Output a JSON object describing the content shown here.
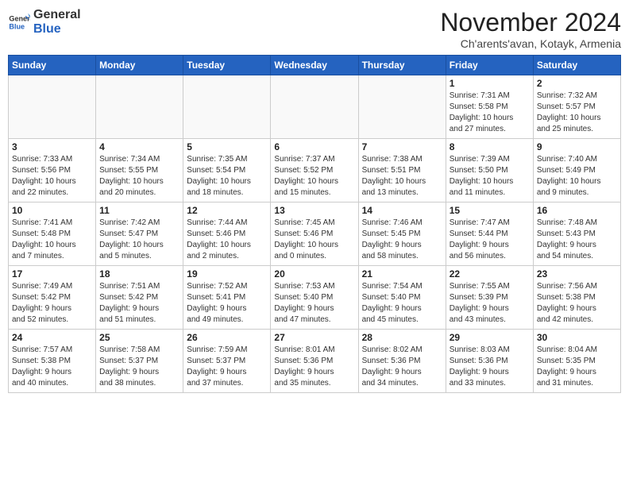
{
  "header": {
    "logo_general": "General",
    "logo_blue": "Blue",
    "title": "November 2024",
    "subtitle": "Ch'arents'avan, Kotayk, Armenia"
  },
  "weekdays": [
    "Sunday",
    "Monday",
    "Tuesday",
    "Wednesday",
    "Thursday",
    "Friday",
    "Saturday"
  ],
  "weeks": [
    [
      {
        "day": "",
        "info": ""
      },
      {
        "day": "",
        "info": ""
      },
      {
        "day": "",
        "info": ""
      },
      {
        "day": "",
        "info": ""
      },
      {
        "day": "",
        "info": ""
      },
      {
        "day": "1",
        "info": "Sunrise: 7:31 AM\nSunset: 5:58 PM\nDaylight: 10 hours\nand 27 minutes."
      },
      {
        "day": "2",
        "info": "Sunrise: 7:32 AM\nSunset: 5:57 PM\nDaylight: 10 hours\nand 25 minutes."
      }
    ],
    [
      {
        "day": "3",
        "info": "Sunrise: 7:33 AM\nSunset: 5:56 PM\nDaylight: 10 hours\nand 22 minutes."
      },
      {
        "day": "4",
        "info": "Sunrise: 7:34 AM\nSunset: 5:55 PM\nDaylight: 10 hours\nand 20 minutes."
      },
      {
        "day": "5",
        "info": "Sunrise: 7:35 AM\nSunset: 5:54 PM\nDaylight: 10 hours\nand 18 minutes."
      },
      {
        "day": "6",
        "info": "Sunrise: 7:37 AM\nSunset: 5:52 PM\nDaylight: 10 hours\nand 15 minutes."
      },
      {
        "day": "7",
        "info": "Sunrise: 7:38 AM\nSunset: 5:51 PM\nDaylight: 10 hours\nand 13 minutes."
      },
      {
        "day": "8",
        "info": "Sunrise: 7:39 AM\nSunset: 5:50 PM\nDaylight: 10 hours\nand 11 minutes."
      },
      {
        "day": "9",
        "info": "Sunrise: 7:40 AM\nSunset: 5:49 PM\nDaylight: 10 hours\nand 9 minutes."
      }
    ],
    [
      {
        "day": "10",
        "info": "Sunrise: 7:41 AM\nSunset: 5:48 PM\nDaylight: 10 hours\nand 7 minutes."
      },
      {
        "day": "11",
        "info": "Sunrise: 7:42 AM\nSunset: 5:47 PM\nDaylight: 10 hours\nand 5 minutes."
      },
      {
        "day": "12",
        "info": "Sunrise: 7:44 AM\nSunset: 5:46 PM\nDaylight: 10 hours\nand 2 minutes."
      },
      {
        "day": "13",
        "info": "Sunrise: 7:45 AM\nSunset: 5:46 PM\nDaylight: 10 hours\nand 0 minutes."
      },
      {
        "day": "14",
        "info": "Sunrise: 7:46 AM\nSunset: 5:45 PM\nDaylight: 9 hours\nand 58 minutes."
      },
      {
        "day": "15",
        "info": "Sunrise: 7:47 AM\nSunset: 5:44 PM\nDaylight: 9 hours\nand 56 minutes."
      },
      {
        "day": "16",
        "info": "Sunrise: 7:48 AM\nSunset: 5:43 PM\nDaylight: 9 hours\nand 54 minutes."
      }
    ],
    [
      {
        "day": "17",
        "info": "Sunrise: 7:49 AM\nSunset: 5:42 PM\nDaylight: 9 hours\nand 52 minutes."
      },
      {
        "day": "18",
        "info": "Sunrise: 7:51 AM\nSunset: 5:42 PM\nDaylight: 9 hours\nand 51 minutes."
      },
      {
        "day": "19",
        "info": "Sunrise: 7:52 AM\nSunset: 5:41 PM\nDaylight: 9 hours\nand 49 minutes."
      },
      {
        "day": "20",
        "info": "Sunrise: 7:53 AM\nSunset: 5:40 PM\nDaylight: 9 hours\nand 47 minutes."
      },
      {
        "day": "21",
        "info": "Sunrise: 7:54 AM\nSunset: 5:40 PM\nDaylight: 9 hours\nand 45 minutes."
      },
      {
        "day": "22",
        "info": "Sunrise: 7:55 AM\nSunset: 5:39 PM\nDaylight: 9 hours\nand 43 minutes."
      },
      {
        "day": "23",
        "info": "Sunrise: 7:56 AM\nSunset: 5:38 PM\nDaylight: 9 hours\nand 42 minutes."
      }
    ],
    [
      {
        "day": "24",
        "info": "Sunrise: 7:57 AM\nSunset: 5:38 PM\nDaylight: 9 hours\nand 40 minutes."
      },
      {
        "day": "25",
        "info": "Sunrise: 7:58 AM\nSunset: 5:37 PM\nDaylight: 9 hours\nand 38 minutes."
      },
      {
        "day": "26",
        "info": "Sunrise: 7:59 AM\nSunset: 5:37 PM\nDaylight: 9 hours\nand 37 minutes."
      },
      {
        "day": "27",
        "info": "Sunrise: 8:01 AM\nSunset: 5:36 PM\nDaylight: 9 hours\nand 35 minutes."
      },
      {
        "day": "28",
        "info": "Sunrise: 8:02 AM\nSunset: 5:36 PM\nDaylight: 9 hours\nand 34 minutes."
      },
      {
        "day": "29",
        "info": "Sunrise: 8:03 AM\nSunset: 5:36 PM\nDaylight: 9 hours\nand 33 minutes."
      },
      {
        "day": "30",
        "info": "Sunrise: 8:04 AM\nSunset: 5:35 PM\nDaylight: 9 hours\nand 31 minutes."
      }
    ]
  ]
}
